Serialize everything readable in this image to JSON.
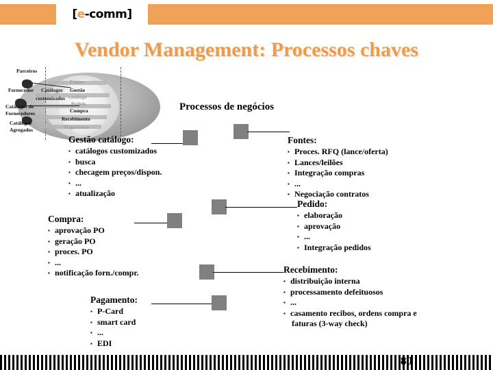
{
  "header": {
    "logo_prefix": "[",
    "logo_highlight": "e",
    "logo_suffix": "-comm]"
  },
  "slide": {
    "title": "Vendor Management: Processos chaves",
    "page_number": "80"
  },
  "diagram": {
    "left_labels": [
      "Parceiros",
      "Fornecedor",
      "Catálogos de",
      "Fornecedores",
      "Catálogos",
      "Agregados"
    ],
    "mid_labels": [
      "Catálogos",
      "customizados"
    ],
    "right_labels": [
      "Fontes",
      "Gestão",
      "catálogo",
      "Pedido",
      "Compra",
      "Recebimento",
      "Pagamento"
    ]
  },
  "main": {
    "section_heading": "Processos de negócios",
    "blocks": [
      {
        "id": "gestao-catalogo",
        "title": "Gestão catálogo:",
        "items": [
          "catálogos customizados",
          "busca",
          "checagem preços/dispon.",
          "...",
          "atualização"
        ]
      },
      {
        "id": "compra",
        "title": "Compra:",
        "items": [
          "aprovação PO",
          "geração PO",
          "proces. PO",
          "...",
          "notificação forn./compr."
        ]
      },
      {
        "id": "pagamento",
        "title": "Pagamento:",
        "items": [
          "P-Card",
          "smart card",
          "...",
          "EDI"
        ]
      },
      {
        "id": "fontes",
        "title": "Fontes:",
        "items": [
          "Proces. RFQ (lance/oferta)",
          "Lances/leilões",
          "Integração compras",
          "...",
          "Negociação contratos"
        ]
      },
      {
        "id": "pedido",
        "title": "Pedido:",
        "items": [
          "elaboração",
          "aprovação",
          "...",
          "Integração pedidos"
        ]
      },
      {
        "id": "recebimento",
        "title": "Recebimento:",
        "items": [
          "distribuição interna",
          "processamento defeituosos",
          "...",
          "casamento recibos, ordens compra e",
          "faturas (3-way check)"
        ]
      }
    ]
  },
  "colors": {
    "accent_orange": "#F0A358",
    "title_orange": "#EC9C4E",
    "connector_gray": "#808080"
  }
}
